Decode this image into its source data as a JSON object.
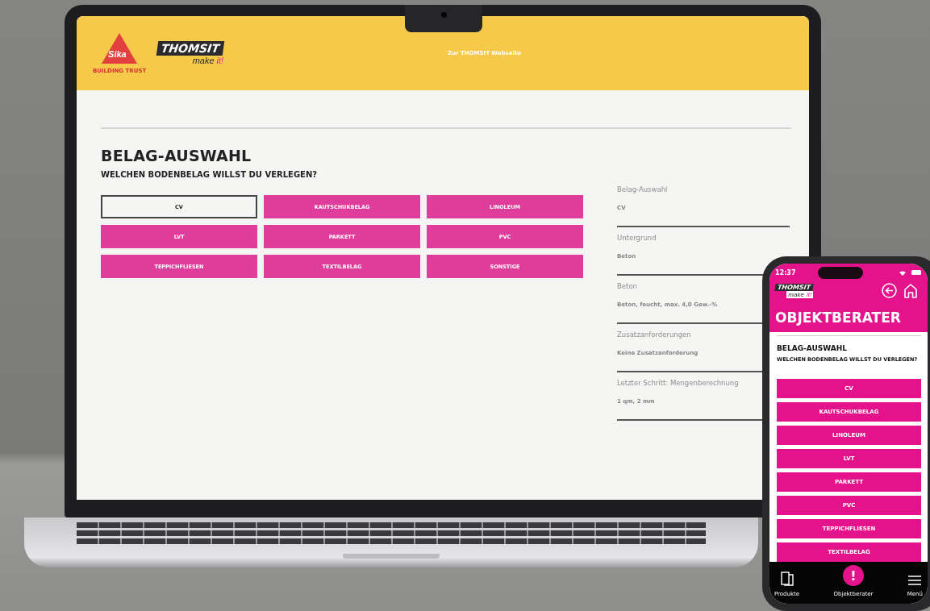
{
  "laptop": {
    "header": {
      "sika_logo": {
        "mark": "Sika",
        "tagline": "BUILDING TRUST"
      },
      "thomsit_logo": {
        "name": "THOMSIT",
        "slogan_start": "make",
        "slogan_end": "it!"
      },
      "link": "Zur THOMSIT Webseite"
    },
    "title": "BELAG-AUSWAHL",
    "question": "WELCHEN BODENBELAG WILLST DU VERLEGEN?",
    "options": [
      {
        "label": "CV",
        "selected": true
      },
      {
        "label": "KAUTSCHUKBELAG",
        "selected": false
      },
      {
        "label": "LINOLEUM",
        "selected": false
      },
      {
        "label": "LVT",
        "selected": false
      },
      {
        "label": "PARKETT",
        "selected": false
      },
      {
        "label": "PVC",
        "selected": false
      },
      {
        "label": "TEPPICHFLIESEN",
        "selected": false
      },
      {
        "label": "TEXTILBELAG",
        "selected": false
      },
      {
        "label": "SONSTIGE",
        "selected": false
      }
    ],
    "summary": [
      {
        "label": "Belag-Auswahl",
        "value": "CV"
      },
      {
        "label": "Untergrund",
        "value": "Beton"
      },
      {
        "label": "Beton",
        "value": "Beton, feucht, max. 4,0 Gew.-%"
      },
      {
        "label": "Zusatzanforderungen",
        "value": "Keine Zusatzanforderung"
      },
      {
        "label": "Letzter Schritt: Mengenberechnung",
        "value": "1 qm, 2 mm"
      }
    ]
  },
  "phone": {
    "time": "12:37",
    "logo": {
      "name": "THOMSIT",
      "slogan_start": "make",
      "slogan_end": "it!"
    },
    "header_title": "OBJEKTBERATER",
    "title": "BELAG-AUSWAHL",
    "question": "WELCHEN BODENBELAG WILLST DU VERLEGEN?",
    "options": [
      {
        "label": "CV",
        "selected": false
      },
      {
        "label": "KAUTSCHUKBELAG",
        "selected": false
      },
      {
        "label": "LINOLEUM",
        "selected": false
      },
      {
        "label": "LVT",
        "selected": false
      },
      {
        "label": "PARKETT",
        "selected": false
      },
      {
        "label": "PVC",
        "selected": false
      },
      {
        "label": "TEPPICHFLIESEN",
        "selected": false
      },
      {
        "label": "TEXTILBELAG",
        "selected": false
      }
    ],
    "nav": [
      {
        "kind": "products",
        "label": "Produkte"
      },
      {
        "kind": "advisor",
        "label": "Objektberater",
        "glyph": "!"
      },
      {
        "kind": "menu",
        "label": "Menü"
      }
    ]
  }
}
